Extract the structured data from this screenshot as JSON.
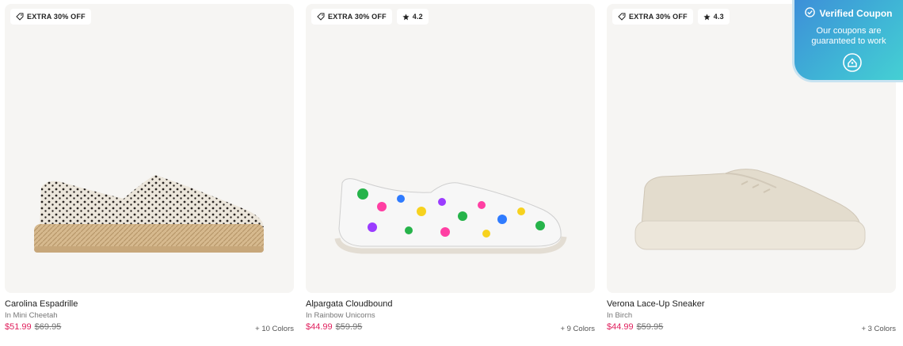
{
  "products": [
    {
      "badges": [
        {
          "icon": "tag-icon",
          "text": "EXTRA 30% OFF"
        }
      ],
      "name": "Carolina Espadrille",
      "variant": "In Mini Cheetah",
      "sale_price": "$51.99",
      "original_price": "$69.95",
      "colors": "+ 10 Colors"
    },
    {
      "badges": [
        {
          "icon": "tag-icon",
          "text": "EXTRA 30% OFF"
        },
        {
          "icon": "star-icon",
          "text": "4.2"
        }
      ],
      "name": "Alpargata Cloudbound",
      "variant": "In Rainbow Unicorns",
      "sale_price": "$44.99",
      "original_price": "$59.95",
      "colors": "+ 9 Colors"
    },
    {
      "badges": [
        {
          "icon": "tag-icon",
          "text": "EXTRA 30% OFF"
        },
        {
          "icon": "star-icon",
          "text": "4.3"
        }
      ],
      "name": "Verona Lace-Up Sneaker",
      "variant": "In Birch",
      "sale_price": "$44.99",
      "original_price": "$59.95",
      "colors": "+ 3 Colors"
    }
  ],
  "coupon": {
    "title": "Verified Coupon",
    "subtitle": "Our coupons are guaranteed to work"
  },
  "colors": {
    "sale": "#e0215e",
    "image_bg": "#f6f5f3",
    "coupon_start": "#3d8fd8",
    "coupon_end": "#45d0d3"
  }
}
